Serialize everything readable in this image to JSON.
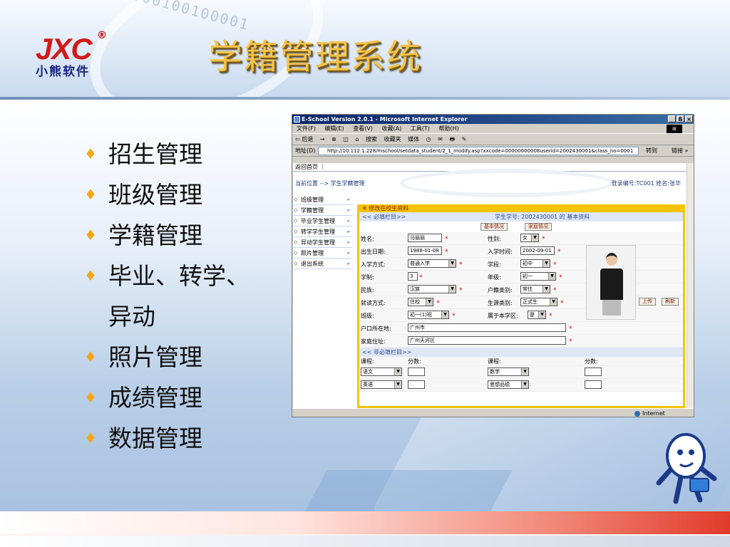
{
  "slide": {
    "title": "学籍管理系统",
    "logo": {
      "brand": "JXC",
      "registered": "®",
      "subtitle": "小熊软件"
    },
    "bullets": [
      "招生管理",
      "班级管理",
      "学籍管理",
      "毕业、转学、",
      "异动",
      "照片管理",
      "成绩管理",
      "数据管理"
    ],
    "colors": {
      "title": "#f2c24a",
      "bullet": "#f2a71b",
      "logo_red": "#d11a1a"
    }
  },
  "ie": {
    "title": "E-School Version 2.0.1 - Microsoft Internet Explorer",
    "window_buttons": [
      "_",
      "ß",
      "×"
    ],
    "menu": [
      "文件(F)",
      "编辑(E)",
      "查看(V)",
      "收藏(A)",
      "工具(T)",
      "帮助(H)"
    ],
    "toolbar": [
      "⇦ 后退",
      "→",
      "⊗",
      "◫",
      "⌂",
      "搜索",
      "收藏夹",
      "媒体",
      "◷",
      "✉",
      "🖶",
      "✎"
    ],
    "address_label": "地址(D)",
    "address_url": "http://10.112.1.228/mschool/setdata_student/2_1_modify.asp?xxcode=00000000008userid=2002430001&class_no=0001",
    "go": "转到",
    "links": "链接 »",
    "status": "Internet"
  },
  "page": {
    "top_link": "返回首页 ｜",
    "location": "当前位置 --> 学生学籍管理",
    "login_info": "登录编号:TC001    姓名:张华",
    "nav": [
      "班级管理",
      "学籍管理",
      "毕业学生管理",
      "转学学生管理",
      "异动学生管理",
      "照片管理",
      "退出系统"
    ],
    "form_header": "※ 修改在校生资料",
    "required_section": "<< 必填栏目>>",
    "student_heading": "学生学号: 2002430001 的 基本资料",
    "tab_basic": "基本情况",
    "tab_family": "家庭情况",
    "fields": {
      "name_label": "姓名:",
      "name": "马丽丽",
      "gender_label": "性别:",
      "gender": "女",
      "birth_label": "出生日期:",
      "birth": "1988-01-08",
      "enroll_label": "入学时间:",
      "enroll": "2002-09-01",
      "mode_label": "入学方式:",
      "mode": "普通入学",
      "stage_label": "学段:",
      "stage": "初中",
      "years_label": "学制:",
      "years": "3",
      "grade_label": "年级:",
      "grade": "初一",
      "ethnic_label": "民族:",
      "ethnic": "汉族",
      "hukou_label": "户籍类别:",
      "hukou": "常住",
      "study_label": "就读方式:",
      "study": "住校",
      "source_label": "生源类别:",
      "source": "正式生",
      "class_label": "班级:",
      "class": "初一(1)班",
      "district_label": "属于本学区:",
      "district": "是",
      "hukou_place_label": "户口所在地:",
      "hukou_place": "广州市",
      "address_label": "家庭住址:",
      "address": "广州天河区"
    },
    "upload": "上传",
    "refresh": "刷新",
    "optional_section": "<< 非必填栏目>>",
    "course_label": "课程:",
    "score_label": "分数:",
    "courses": [
      "语文",
      "数学",
      "英语",
      "思想品德"
    ]
  }
}
